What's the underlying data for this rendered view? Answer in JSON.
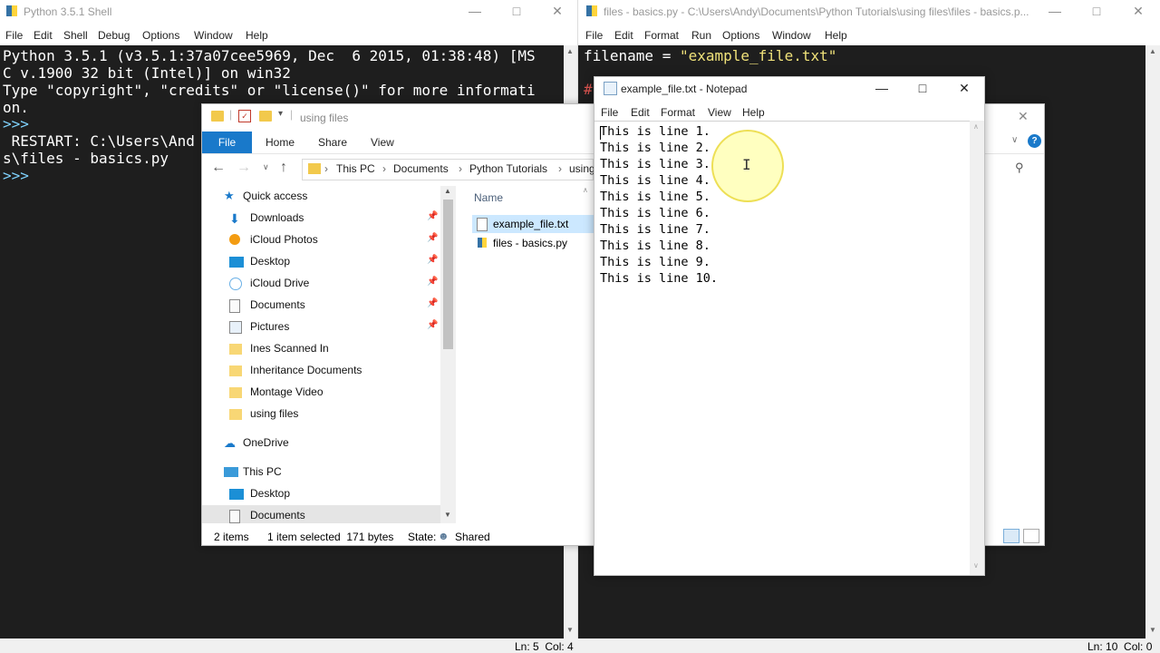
{
  "shell": {
    "title": "Python 3.5.1 Shell",
    "menu": [
      "File",
      "Edit",
      "Shell",
      "Debug",
      "Options",
      "Window",
      "Help"
    ],
    "lines": [
      "Python 3.5.1 (v3.5.1:37a07cee5969, Dec  6 2015, 01:38:48) [MS",
      "C v.1900 32 bit (Intel)] on win32",
      "Type \"copyright\", \"credits\" or \"license()\" for more informati",
      "on.",
      ">>> ",
      " RESTART: C:\\Users\\And",
      "s\\files - basics.py",
      ">>> "
    ],
    "status": "Ln: 5  Col: 4"
  },
  "editor": {
    "title": "files - basics.py - C:\\Users\\Andy\\Documents\\Python Tutorials\\using files\\files - basics.p...",
    "menu": [
      "File",
      "Edit",
      "Format",
      "Run",
      "Options",
      "Window",
      "Help"
    ],
    "code_prefix": "filename = ",
    "code_string": "\"example_file.txt\"",
    "comment_char": "#",
    "status": "Ln: 10  Col: 0"
  },
  "explorer": {
    "title": "using files",
    "ribbon": [
      "File",
      "Home",
      "Share",
      "View"
    ],
    "breadcrumb": [
      "This PC",
      "Documents",
      "Python Tutorials",
      "using"
    ],
    "nav_items": [
      {
        "label": "Quick access",
        "icon": "star-icon",
        "pinned": false
      },
      {
        "label": "Downloads",
        "icon": "download-icon",
        "pinned": true
      },
      {
        "label": "iCloud Photos",
        "icon": "photos-icon",
        "pinned": true
      },
      {
        "label": "Desktop",
        "icon": "desktop-icon",
        "pinned": true
      },
      {
        "label": "iCloud Drive",
        "icon": "cloud-icon",
        "pinned": true
      },
      {
        "label": "Documents",
        "icon": "documents-icon",
        "pinned": true
      },
      {
        "label": "Pictures",
        "icon": "pictures-icon",
        "pinned": true
      },
      {
        "label": "Ines Scanned In",
        "icon": "folder-icon",
        "pinned": false
      },
      {
        "label": "Inheritance Documents",
        "icon": "folder-icon",
        "pinned": false
      },
      {
        "label": "Montage Video",
        "icon": "folder-icon",
        "pinned": false
      },
      {
        "label": "using files",
        "icon": "folder-icon",
        "pinned": false
      },
      {
        "label": "OneDrive",
        "icon": "onedrive-icon",
        "pinned": false
      },
      {
        "label": "This PC",
        "icon": "computer-icon",
        "pinned": false
      },
      {
        "label": "Desktop",
        "icon": "desktop-icon",
        "pinned": false
      },
      {
        "label": "Documents",
        "icon": "documents-icon",
        "pinned": false
      }
    ],
    "column_header": "Name",
    "files": [
      {
        "name": "example_file.txt",
        "icon": "text-file-icon"
      },
      {
        "name": "files - basics.py",
        "icon": "python-file-icon"
      }
    ],
    "status": {
      "items": "2 items",
      "selected": "1 item selected  171 bytes",
      "state_label": "State:",
      "state_value": "Shared"
    }
  },
  "notepad": {
    "title": "example_file.txt - Notepad",
    "menu": [
      "File",
      "Edit",
      "Format",
      "View",
      "Help"
    ],
    "lines": [
      "This is line 1.",
      "This is line 2.",
      "This is line 3.",
      "This is line 4.",
      "This is line 5.",
      "This is line 6.",
      "This is line 7.",
      "This is line 8.",
      "This is line 9.",
      "This is line 10."
    ]
  },
  "colors": {
    "editor_bg": "#1e1e1e",
    "string_color": "#f0e27a",
    "prompt_color": "#7fd3ff",
    "accent_blue": "#1979ca",
    "highlight": "#fff98c"
  }
}
